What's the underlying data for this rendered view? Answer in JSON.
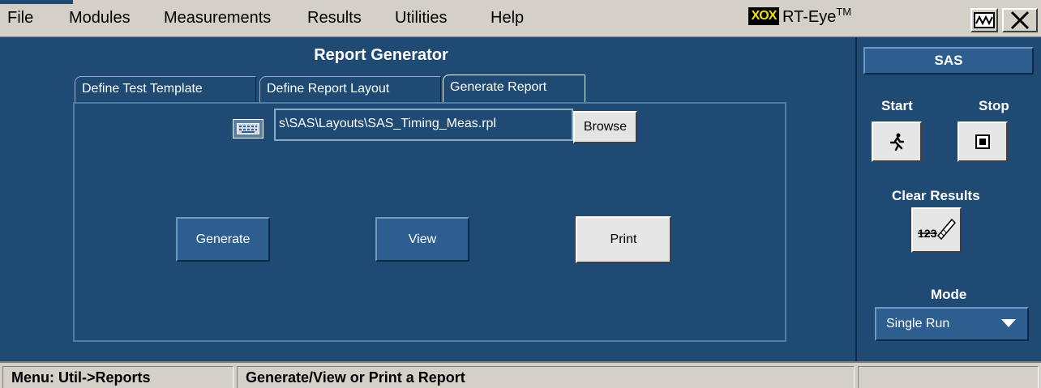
{
  "menubar": {
    "items": [
      "File",
      "Modules",
      "Measurements",
      "Results",
      "Utilities",
      "Help"
    ],
    "brand": {
      "logo": "XOX",
      "name": "RT-Eye",
      "tm": "TM"
    }
  },
  "window_icons": [
    "waveform-icon",
    "close-icon"
  ],
  "panel": {
    "title": "Report Generator",
    "tabs": [
      "Define Test Template",
      "Define Report Layout",
      "Generate Report"
    ],
    "active_tab": "Generate Report",
    "file_path": "s\\SAS\\Layouts\\SAS_Timing_Meas.rpl",
    "browse_label": "Browse",
    "generate_label": "Generate",
    "view_label": "View",
    "print_label": "Print"
  },
  "right_panel": {
    "header": "SAS",
    "start_label": "Start",
    "stop_label": "Stop",
    "clear_label": "Clear Results",
    "clear_icon_text": "123",
    "mode_label": "Mode",
    "mode_value": "Single Run"
  },
  "status": {
    "menu_path": "Menu: Util->Reports",
    "message": "Generate/View or Print a Report"
  },
  "colors": {
    "panel_bg": "#1f4a73",
    "button_blue": "#2d5e8f",
    "chrome_grey": "#d4d0c8"
  }
}
